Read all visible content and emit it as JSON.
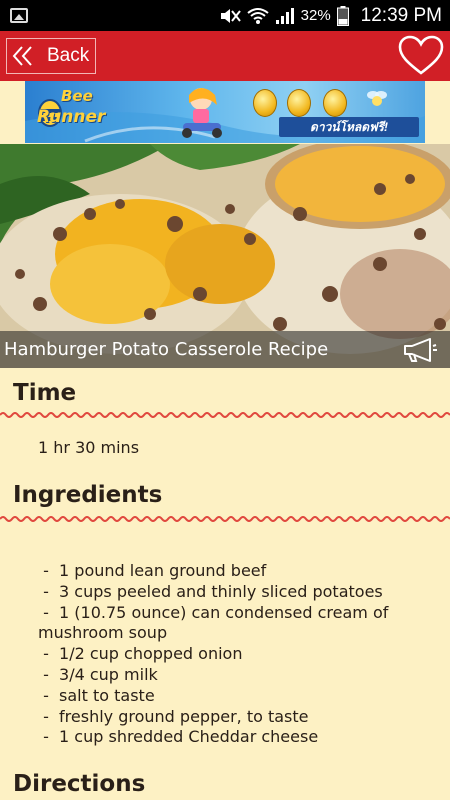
{
  "status_bar": {
    "battery_percent": "32%",
    "time": "12:39 PM"
  },
  "app_bar": {
    "back_label": "Back"
  },
  "ad": {
    "logo_line1": "Bee",
    "logo_line2": "Runner",
    "cta_text": "ดาวน์โหลดฟรี!"
  },
  "recipe": {
    "title": "Hamburger Potato Casserole Recipe",
    "time_heading": "Time",
    "time_value": "1 hr 30 mins",
    "ingredients_heading": "Ingredients",
    "ingredients": [
      " -  1 pound lean ground beef",
      " -  3 cups peeled and thinly sliced potatoes",
      " -  1 (10.75 ounce) can condensed cream of mushroom soup",
      " -  1/2 cup chopped onion",
      " -  3/4 cup milk",
      " -  salt to taste",
      " -  freshly ground pepper, to taste",
      " -  1 cup shredded Cheddar cheese"
    ],
    "directions_heading": "Directions"
  },
  "colors": {
    "app_bar": "#d11f26",
    "background": "#fdf1c4",
    "wavy_divider": "#e0483e"
  },
  "icons": {
    "back": "double-chevron-left-icon",
    "favorite": "heart-outline-icon",
    "speak": "megaphone-icon"
  }
}
